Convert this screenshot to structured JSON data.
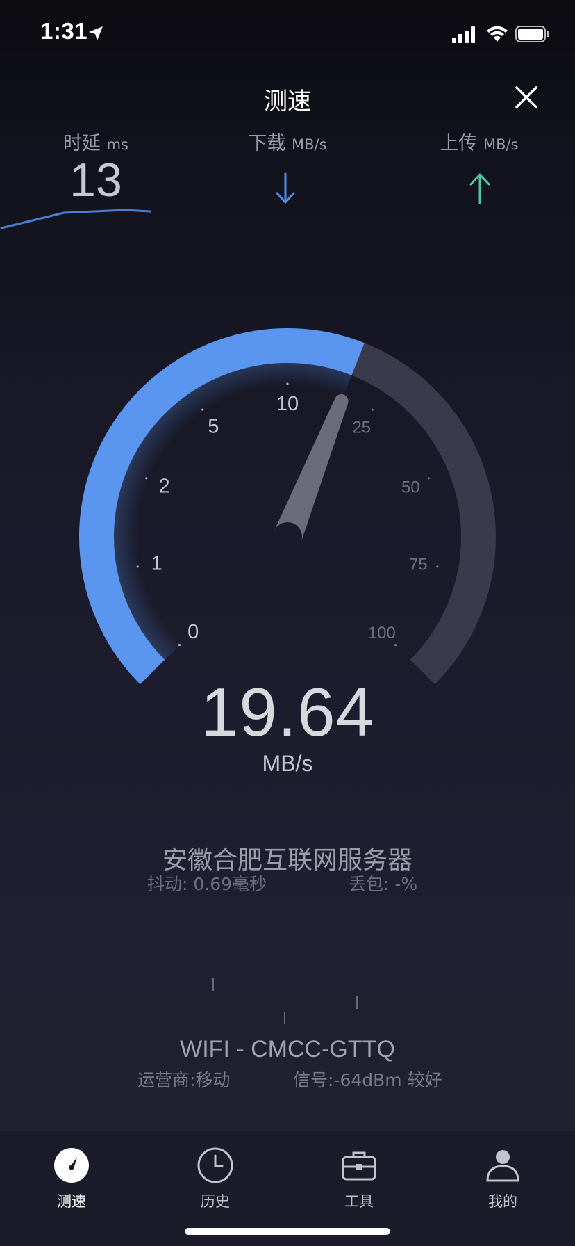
{
  "status_bar": {
    "time": "1:31"
  },
  "header": {
    "title": "测速"
  },
  "metrics": {
    "latency": {
      "label": "时延",
      "unit": "ms",
      "value": "13"
    },
    "download": {
      "label": "下载",
      "unit": "MB/s"
    },
    "upload": {
      "label": "上传",
      "unit": "MB/s"
    }
  },
  "gauge": {
    "scale_labels": [
      "0",
      "1",
      "2",
      "5",
      "10",
      "25",
      "50",
      "75",
      "100"
    ],
    "current_value": 19.64,
    "max_value": 100,
    "colors": {
      "active": "#5a96f0",
      "inactive": "#3a3a4c",
      "needle": "#6b6b7c"
    }
  },
  "result": {
    "speed": "19.64",
    "unit": "MB/s"
  },
  "server": {
    "name": "安徽合肥互联网服务器",
    "jitter": "抖动: 0.69毫秒",
    "packet_loss": "丢包: -%"
  },
  "network": {
    "wifi": "WIFI - CMCC-GTTQ",
    "carrier": "运营商:移动",
    "signal": "信号:-64dBm 较好"
  },
  "tabs": [
    {
      "label": "测速",
      "icon": "speedometer-icon",
      "active": true
    },
    {
      "label": "历史",
      "icon": "clock-icon",
      "active": false
    },
    {
      "label": "工具",
      "icon": "toolbox-icon",
      "active": false
    },
    {
      "label": "我的",
      "icon": "user-icon",
      "active": false
    }
  ]
}
